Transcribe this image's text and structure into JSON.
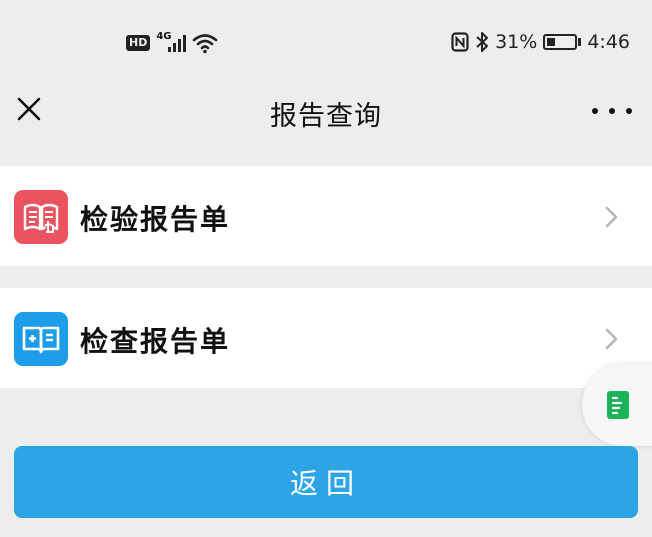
{
  "status_bar": {
    "hd_label": "HD",
    "network_label": "4G",
    "battery_percent": "31%",
    "time": "4:46",
    "icons": [
      "hd-icon",
      "signal-icon",
      "wifi-icon",
      "nfc-icon",
      "bluetooth-icon",
      "battery-icon"
    ]
  },
  "nav": {
    "title": "报告查询",
    "close_icon": "close-icon",
    "more_icon": "more-icon"
  },
  "items": [
    {
      "label": "检验报告单",
      "icon": "lab-report-icon",
      "icon_color": "#ec5360"
    },
    {
      "label": "检查报告单",
      "icon": "exam-report-icon",
      "icon_color": "#1d9ce8"
    }
  ],
  "floating": {
    "icon": "document-icon",
    "icon_color": "#19b35a"
  },
  "back_button": {
    "label": "返回",
    "color": "#2ca4e6"
  }
}
